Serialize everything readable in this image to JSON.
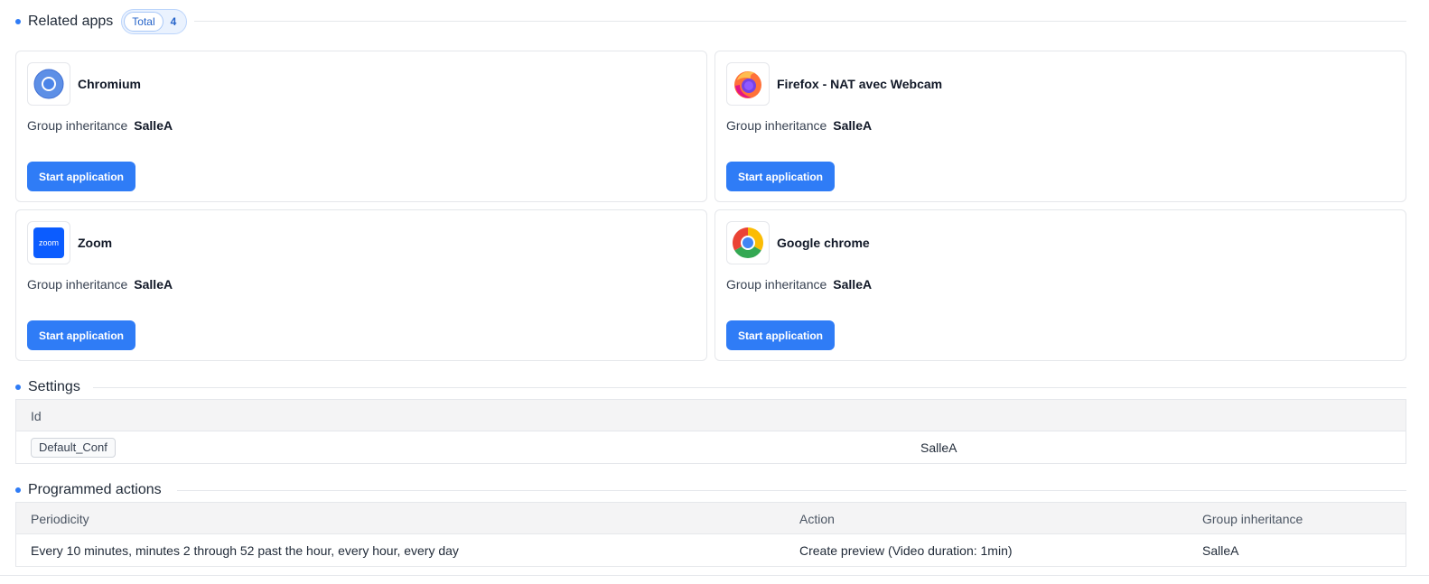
{
  "related_apps": {
    "title": "Related apps",
    "total_label": "Total",
    "total_count": "4",
    "inheritance_label": "Group inheritance",
    "start_label": "Start application",
    "apps": [
      {
        "name": "Chromium",
        "inheritance": "SalleA",
        "icon": "chromium-icon"
      },
      {
        "name": "Firefox - NAT avec Webcam",
        "inheritance": "SalleA",
        "icon": "firefox-icon"
      },
      {
        "name": "Zoom",
        "inheritance": "SalleA",
        "icon": "zoom-icon",
        "icon_text": "zoom"
      },
      {
        "name": "Google chrome",
        "inheritance": "SalleA",
        "icon": "chrome-icon"
      }
    ]
  },
  "settings": {
    "title": "Settings",
    "columns": [
      "Id"
    ],
    "rows": [
      {
        "id": "Default_Conf",
        "value": "SalleA"
      }
    ]
  },
  "programmed_actions": {
    "title": "Programmed actions",
    "columns": [
      "Periodicity",
      "Action",
      "Group inheritance"
    ],
    "rows": [
      {
        "periodicity": "Every 10 minutes, minutes 2 through 52 past the hour, every hour, every day",
        "action": "Create preview (Video duration: 1min)",
        "inheritance": "SalleA"
      }
    ]
  },
  "colors": {
    "accent": "#2f7cf6",
    "border": "#e5e7eb",
    "header_bg": "#f4f4f5"
  }
}
